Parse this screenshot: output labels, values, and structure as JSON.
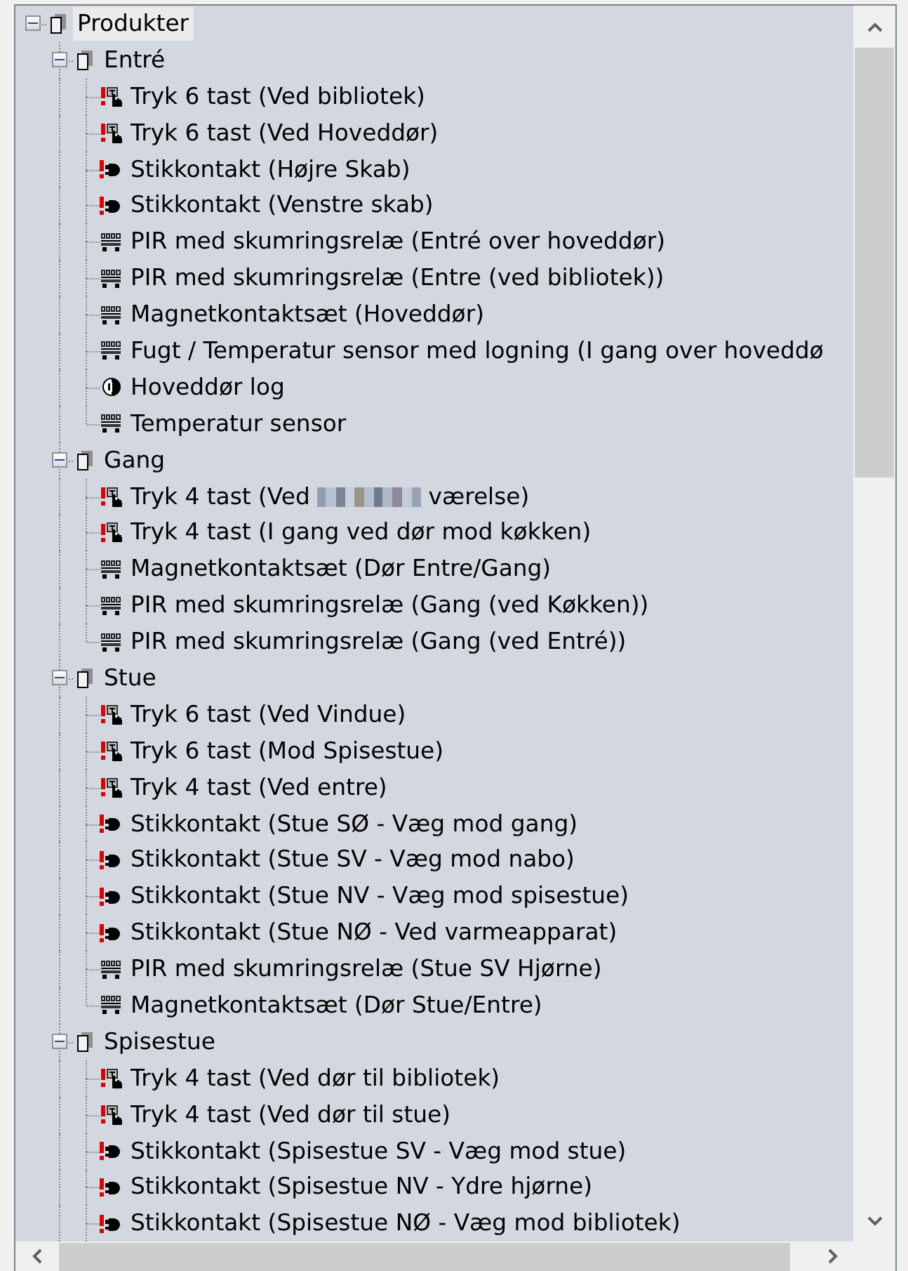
{
  "tree": {
    "kind": "group",
    "label": "Produkter",
    "selected": true,
    "expanded": true,
    "children": [
      {
        "kind": "group",
        "label": "Entré",
        "selected": false,
        "expanded": true,
        "children": [
          {
            "kind": "keypad",
            "warning": true,
            "label": "Tryk 6 tast (Ved bibliotek)",
            "selected": false
          },
          {
            "kind": "keypad",
            "warning": true,
            "label": "Tryk 6 tast (Ved Hoveddør)",
            "selected": false
          },
          {
            "kind": "outlet",
            "warning": true,
            "label": "Stikkontakt (Højre Skab)",
            "selected": false
          },
          {
            "kind": "outlet",
            "warning": true,
            "label": "Stikkontakt (Venstre skab)",
            "selected": false
          },
          {
            "kind": "module",
            "warning": false,
            "label": "PIR med skumringsrelæ (Entré over hoveddør)",
            "selected": false
          },
          {
            "kind": "module",
            "warning": false,
            "label": "PIR med skumringsrelæ (Entre (ved bibliotek))",
            "selected": false
          },
          {
            "kind": "module",
            "warning": false,
            "label": "Magnetkontaktsæt (Hoveddør)",
            "selected": false
          },
          {
            "kind": "module",
            "warning": false,
            "label": "Fugt / Temperatur sensor med logning (I gang over hoveddø",
            "selected": false
          },
          {
            "kind": "log",
            "warning": false,
            "label": "Hoveddør log",
            "selected": false
          },
          {
            "kind": "module",
            "warning": false,
            "label": "Temperatur sensor",
            "selected": false
          }
        ]
      },
      {
        "kind": "group",
        "label": "Gang",
        "selected": false,
        "expanded": true,
        "children": [
          {
            "kind": "keypad",
            "warning": true,
            "label": "Tryk 4 tast (Ved",
            "redacted": true,
            "label_after": "værelse)",
            "selected": false
          },
          {
            "kind": "keypad",
            "warning": true,
            "label": "Tryk 4 tast (I gang ved dør mod køkken)",
            "selected": false
          },
          {
            "kind": "module",
            "warning": false,
            "label": "Magnetkontaktsæt (Dør Entre/Gang)",
            "selected": false
          },
          {
            "kind": "module",
            "warning": false,
            "label": "PIR med skumringsrelæ (Gang (ved Køkken))",
            "selected": false
          },
          {
            "kind": "module",
            "warning": false,
            "label": "PIR med skumringsrelæ (Gang (ved Entré))",
            "selected": false
          }
        ]
      },
      {
        "kind": "group",
        "label": "Stue",
        "selected": false,
        "expanded": true,
        "children": [
          {
            "kind": "keypad",
            "warning": true,
            "label": "Tryk 6 tast (Ved Vindue)",
            "selected": false
          },
          {
            "kind": "keypad",
            "warning": true,
            "label": "Tryk 6 tast (Mod Spisestue)",
            "selected": false
          },
          {
            "kind": "keypad",
            "warning": true,
            "label": "Tryk 4 tast (Ved entre)",
            "selected": false
          },
          {
            "kind": "outlet",
            "warning": true,
            "label": "Stikkontakt (Stue SØ - Væg mod gang)",
            "selected": false
          },
          {
            "kind": "outlet",
            "warning": true,
            "label": "Stikkontakt (Stue SV - Væg mod nabo)",
            "selected": false
          },
          {
            "kind": "outlet",
            "warning": true,
            "label": "Stikkontakt (Stue NV - Væg mod spisestue)",
            "selected": false
          },
          {
            "kind": "outlet",
            "warning": true,
            "label": "Stikkontakt (Stue NØ - Ved varmeapparat)",
            "selected": false
          },
          {
            "kind": "module",
            "warning": false,
            "label": "PIR med skumringsrelæ (Stue SV Hjørne)",
            "selected": false
          },
          {
            "kind": "module",
            "warning": false,
            "label": "Magnetkontaktsæt (Dør Stue/Entre)",
            "selected": false
          }
        ]
      },
      {
        "kind": "group",
        "label": "Spisestue",
        "selected": false,
        "expanded": true,
        "children": [
          {
            "kind": "keypad",
            "warning": true,
            "label": "Tryk 4 tast (Ved dør til bibliotek)",
            "selected": false
          },
          {
            "kind": "keypad",
            "warning": true,
            "label": "Tryk 4 tast (Ved dør til stue)",
            "selected": false
          },
          {
            "kind": "outlet",
            "warning": true,
            "label": "Stikkontakt (Spisestue SV - Væg mod stue)",
            "selected": false
          },
          {
            "kind": "outlet",
            "warning": true,
            "label": "Stikkontakt (Spisestue NV - Ydre hjørne)",
            "selected": false
          },
          {
            "kind": "outlet",
            "warning": true,
            "label": "Stikkontakt (Spisestue NØ - Væg mod bibliotek)",
            "selected": false
          }
        ]
      }
    ]
  }
}
